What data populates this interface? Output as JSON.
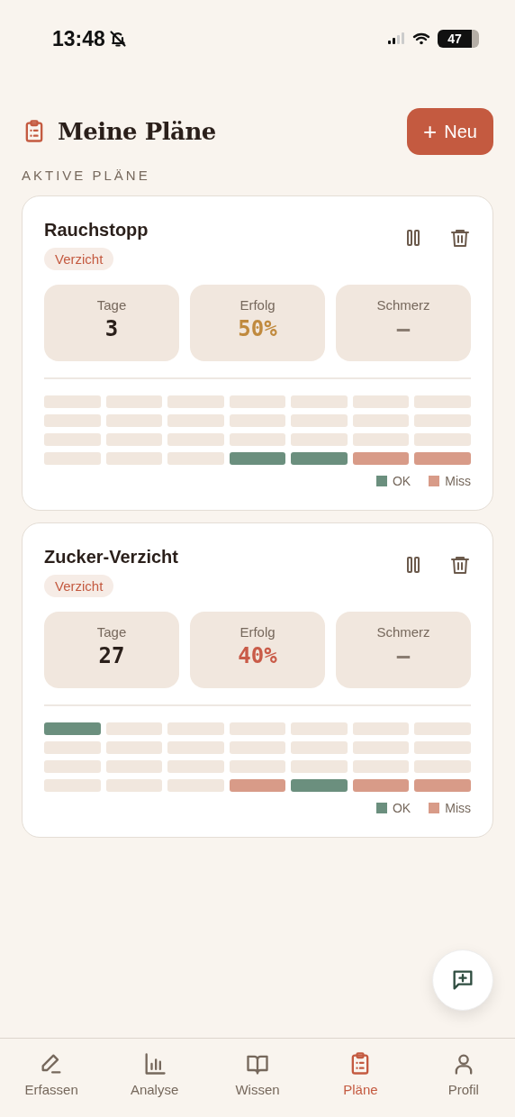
{
  "status_bar": {
    "time": "13:48",
    "battery": "47"
  },
  "header": {
    "title": "Meine Pläne",
    "new_button": {
      "icon": "+",
      "label": "Neu"
    }
  },
  "section_label": "AKTIVE PLÄNE",
  "plans": [
    {
      "name": "Rauchstopp",
      "tag": "Verzicht",
      "stats": [
        {
          "label": "Tage",
          "value": "3",
          "color": "#2a1f1a"
        },
        {
          "label": "Erfolg",
          "value": "50%",
          "color": "#c08a3e"
        },
        {
          "label": "Schmerz",
          "value": "—",
          "color": "#8a7d72"
        }
      ],
      "grid": [
        [
          {
            "kind": "none"
          },
          {
            "kind": "none"
          },
          {
            "kind": "none"
          },
          {
            "kind": "none"
          },
          {
            "kind": "none"
          },
          {
            "kind": "none"
          },
          {
            "kind": "none"
          }
        ],
        [
          {
            "kind": "none"
          },
          {
            "kind": "none"
          },
          {
            "kind": "none"
          },
          {
            "kind": "none"
          },
          {
            "kind": "none"
          },
          {
            "kind": "none"
          },
          {
            "kind": "none"
          }
        ],
        [
          {
            "kind": "none"
          },
          {
            "kind": "none"
          },
          {
            "kind": "none"
          },
          {
            "kind": "none"
          },
          {
            "kind": "none"
          },
          {
            "kind": "none"
          },
          {
            "kind": "none"
          }
        ],
        [
          {
            "kind": "none"
          },
          {
            "kind": "none"
          },
          {
            "kind": "none"
          },
          {
            "kind": "ok"
          },
          {
            "kind": "ok"
          },
          {
            "kind": "miss"
          },
          {
            "kind": "miss"
          }
        ]
      ],
      "legend": [
        {
          "kind": "ok",
          "label": "OK"
        },
        {
          "kind": "miss",
          "label": "Miss"
        }
      ]
    },
    {
      "name": "Zucker-Verzicht",
      "tag": "Verzicht",
      "stats": [
        {
          "label": "Tage",
          "value": "27",
          "color": "#2a1f1a"
        },
        {
          "label": "Erfolg",
          "value": "40%",
          "color": "#c95b48"
        },
        {
          "label": "Schmerz",
          "value": "—",
          "color": "#8a7d72"
        }
      ],
      "grid": [
        [
          {
            "kind": "ok"
          },
          {
            "kind": "none"
          },
          {
            "kind": "none"
          },
          {
            "kind": "none"
          },
          {
            "kind": "none"
          },
          {
            "kind": "none"
          },
          {
            "kind": "none"
          }
        ],
        [
          {
            "kind": "none"
          },
          {
            "kind": "none"
          },
          {
            "kind": "none"
          },
          {
            "kind": "none"
          },
          {
            "kind": "none"
          },
          {
            "kind": "none"
          },
          {
            "kind": "none"
          }
        ],
        [
          {
            "kind": "none"
          },
          {
            "kind": "none"
          },
          {
            "kind": "none"
          },
          {
            "kind": "none"
          },
          {
            "kind": "none"
          },
          {
            "kind": "none"
          },
          {
            "kind": "none"
          }
        ],
        [
          {
            "kind": "none"
          },
          {
            "kind": "none"
          },
          {
            "kind": "none"
          },
          {
            "kind": "miss"
          },
          {
            "kind": "ok"
          },
          {
            "kind": "miss"
          },
          {
            "kind": "miss"
          }
        ]
      ],
      "legend": [
        {
          "kind": "ok",
          "label": "OK"
        },
        {
          "kind": "miss",
          "label": "Miss"
        }
      ]
    }
  ],
  "tab_bar": [
    {
      "kind": "edit",
      "label": "Erfassen",
      "selected": false
    },
    {
      "kind": "chart",
      "label": "Analyse",
      "selected": false
    },
    {
      "kind": "book",
      "label": "Wissen",
      "selected": false
    },
    {
      "kind": "clipboard",
      "label": "Pläne",
      "selected": true
    },
    {
      "kind": "person",
      "label": "Profil",
      "selected": false
    }
  ]
}
